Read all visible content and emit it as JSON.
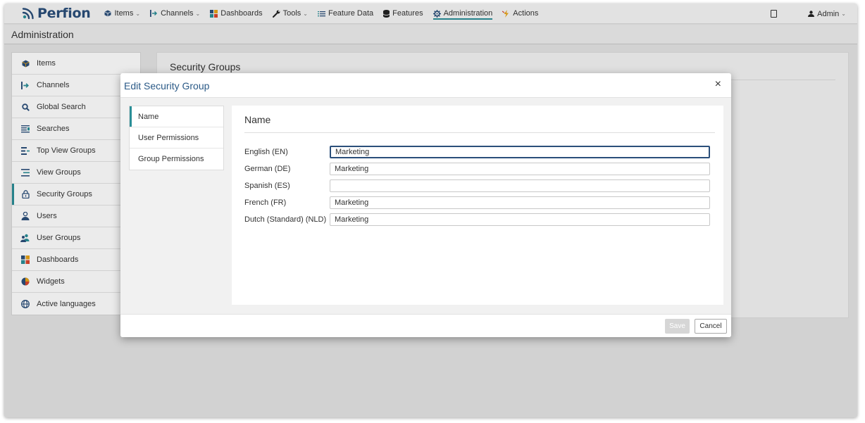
{
  "app": {
    "logo_text": "Perfion"
  },
  "topnav": {
    "items": [
      {
        "label": "Items",
        "icon": "cube-icon",
        "caret": true
      },
      {
        "label": "Channels",
        "icon": "channel-arrow-icon",
        "caret": true
      },
      {
        "label": "Dashboards",
        "icon": "dashboard-grid-icon",
        "caret": false
      },
      {
        "label": "Tools",
        "icon": "wrench-icon",
        "caret": true
      },
      {
        "label": "Feature Data",
        "icon": "list-icon",
        "caret": false
      },
      {
        "label": "Features",
        "icon": "database-icon",
        "caret": false
      },
      {
        "label": "Administration",
        "icon": "gear-icon",
        "caret": false,
        "active": true
      },
      {
        "label": "Actions",
        "icon": "lightning-icon",
        "caret": false
      }
    ],
    "user_label": "Admin",
    "caret_glyph": "⌄"
  },
  "page": {
    "title": "Administration"
  },
  "leftmenu": {
    "items": [
      {
        "label": "Items",
        "icon": "cube-icon"
      },
      {
        "label": "Channels",
        "icon": "channel-arrow-icon"
      },
      {
        "label": "Global Search",
        "icon": "search-icon"
      },
      {
        "label": "Searches",
        "icon": "searches-list-icon"
      },
      {
        "label": "Top View Groups",
        "icon": "top-view-groups-icon"
      },
      {
        "label": "View Groups",
        "icon": "view-groups-icon"
      },
      {
        "label": "Security Groups",
        "icon": "lock-icon",
        "active": true
      },
      {
        "label": "Users",
        "icon": "user-icon"
      },
      {
        "label": "User Groups",
        "icon": "user-group-icon"
      },
      {
        "label": "Dashboards",
        "icon": "dashboard-grid-icon"
      },
      {
        "label": "Widgets",
        "icon": "pie-chart-icon"
      },
      {
        "label": "Active languages",
        "icon": "globe-icon"
      }
    ]
  },
  "background_panel": {
    "title": "Security Groups"
  },
  "modal": {
    "title": "Edit Security Group",
    "close_glyph": "×",
    "tabs": [
      {
        "label": "Name",
        "active": true
      },
      {
        "label": "User Permissions"
      },
      {
        "label": "Group Permissions"
      }
    ],
    "form": {
      "title": "Name",
      "fields": [
        {
          "label": "English (EN)",
          "value": "Marketing",
          "focused": true
        },
        {
          "label": "German (DE)",
          "value": "Marketing"
        },
        {
          "label": "Spanish (ES)",
          "value": ""
        },
        {
          "label": "French (FR)",
          "value": "Marketing"
        },
        {
          "label": "Dutch (Standard) (NLD)",
          "value": "Marketing"
        }
      ]
    },
    "buttons": {
      "save_label": "Save",
      "cancel_label": "Cancel"
    }
  },
  "colors": {
    "accent": "#2a8e97",
    "brand": "#2b4f7a",
    "modal_title": "#2b5a87"
  }
}
